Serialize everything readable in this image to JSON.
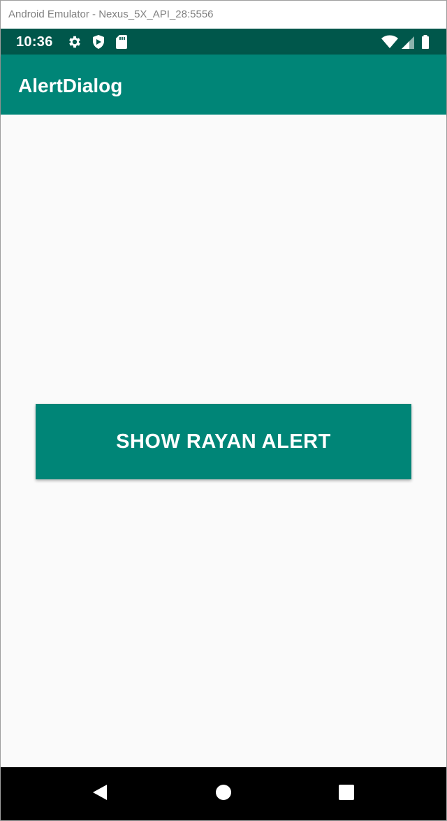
{
  "window": {
    "title": "Android Emulator - Nexus_5X_API_28:5556"
  },
  "status_bar": {
    "time": "10:36",
    "left_icons": [
      "gear-icon",
      "shield-icon",
      "sd-card-icon"
    ],
    "right_icons": [
      "wifi-icon",
      "cell-signal-icon",
      "battery-icon"
    ]
  },
  "app_bar": {
    "title": "AlertDialog"
  },
  "main": {
    "button_label": "SHOW RAYAN ALERT"
  },
  "nav_bar": {
    "buttons": [
      "back-icon",
      "home-icon",
      "recents-icon"
    ]
  },
  "colors": {
    "primary": "#008577",
    "primary_dark": "#00574B",
    "background": "#FAFAFA"
  }
}
